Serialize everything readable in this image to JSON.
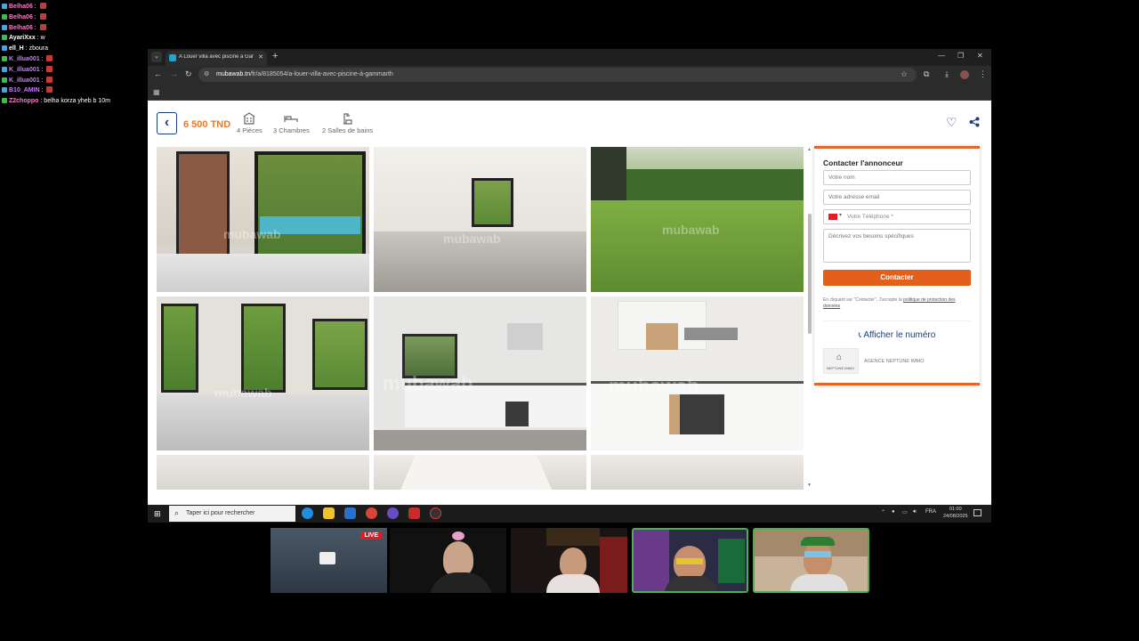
{
  "chat": [
    {
      "user": "Belha06",
      "msg": "",
      "emote": true,
      "color": "#ff7ac8"
    },
    {
      "user": "Belha06",
      "msg": "",
      "emote": true,
      "color": "#ff7ac8"
    },
    {
      "user": "Belha06",
      "msg": "",
      "emote": true,
      "color": "#ff7ac8"
    },
    {
      "user": "AyariXxx",
      "msg": "w",
      "emote": false,
      "color": "#ffffff"
    },
    {
      "user": "ell_H",
      "msg": "zboura",
      "emote": false,
      "color": "#ffffff"
    },
    {
      "user": "K_illua001",
      "msg": "",
      "emote": true,
      "color": "#c77dff"
    },
    {
      "user": "K_illua001",
      "msg": "",
      "emote": true,
      "color": "#c77dff"
    },
    {
      "user": "K_illua001",
      "msg": "",
      "emote": true,
      "color": "#c77dff"
    },
    {
      "user": "B10_AMIN",
      "msg": "",
      "emote": true,
      "color": "#c77dff"
    },
    {
      "user": "Z2choppo",
      "msg": "belha korza yheb b 10m",
      "emote": false,
      "color": "#ff7ac8"
    }
  ],
  "browser": {
    "tab_title": "A Louer villa avec piscine à Gam",
    "url_host": "mubawab.tn",
    "url_path": "/fr/a/8185054/a-louer-villa-avec-piscine-à-gammarth"
  },
  "listing": {
    "price": "6 500 TND",
    "features": [
      {
        "icon": "building-icon",
        "label": "4 Pièces"
      },
      {
        "icon": "bed-icon",
        "label": "3 Chambres"
      },
      {
        "icon": "shower-icon",
        "label": "2 Salles de bains"
      }
    ],
    "watermark": "mubawab"
  },
  "contact": {
    "title": "Contacter l'annonceur",
    "name_placeholder": "Votre nom",
    "email_placeholder": "Votre adresse email",
    "phone_placeholder": "Votre Téléphone *",
    "message_placeholder": "Décrivez vos besoins spécifiques",
    "button_label": "Contacter",
    "consent_text": "En cliquant sur \"Contacter\", J'accepte la ",
    "consent_link": "politique de protection des données",
    "show_number": "Afficher le numéro",
    "agency_name": "AGENCE NEPTUNE IMMO",
    "agency_logo_text": "NEPTUNE IMMO"
  },
  "taskbar": {
    "search_placeholder": "Taper ici pour rechercher",
    "language": "FRA",
    "time": "01:00",
    "date": "24/08/2025"
  },
  "stream": {
    "live_label": "LIVE"
  },
  "colors": {
    "accent_orange": "#e2601c",
    "brand_blue": "#1c3e78",
    "price_orange": "#e07b2e"
  }
}
